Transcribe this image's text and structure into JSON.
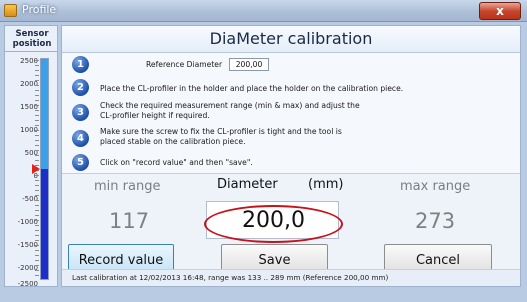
{
  "window": {
    "title": "Profile",
    "close_glyph": "x"
  },
  "sensor": {
    "title_line1": "Sensor",
    "title_line2": "position",
    "ticks": [
      "2500",
      "2000",
      "1500",
      "1000",
      "500",
      "0",
      "-500",
      "-1000",
      "-1500",
      "-2000",
      "-2500"
    ],
    "marker_value": 0,
    "colors": {
      "fill": "#1e2fc9",
      "upper_fill": "#3aa0e8",
      "marker": "#e2221c"
    }
  },
  "main": {
    "title": "DiaMeter calibration",
    "steps": [
      {
        "num": "1",
        "text": "Reference Diameter",
        "input_value": "200,00"
      },
      {
        "num": "2",
        "text": "Place the CL-profiler in the holder and place the holder on the calibration piece."
      },
      {
        "num": "3",
        "line1": "Check the required measurement range (min & max) and adjust the",
        "line2": "CL-profiler height if required."
      },
      {
        "num": "4",
        "line1": "Make sure the screw to fix the CL-profiler is tight and the tool is",
        "line2": "placed stable on the calibration piece."
      },
      {
        "num": "5",
        "text": "Click on \"record value\" and then \"save\"."
      }
    ],
    "min_range": {
      "label": "min range",
      "value": "117"
    },
    "diameter": {
      "label": "Diameter",
      "unit": "(mm)",
      "value": "200,0"
    },
    "max_range": {
      "label": "max range",
      "value": "273"
    },
    "buttons": {
      "record": "Record value",
      "save": "Save",
      "cancel": "Cancel"
    },
    "status": "Last calibration at 12/02/2013 16:48, range was 133 .. 289 mm (Reference 200,00 mm)"
  }
}
